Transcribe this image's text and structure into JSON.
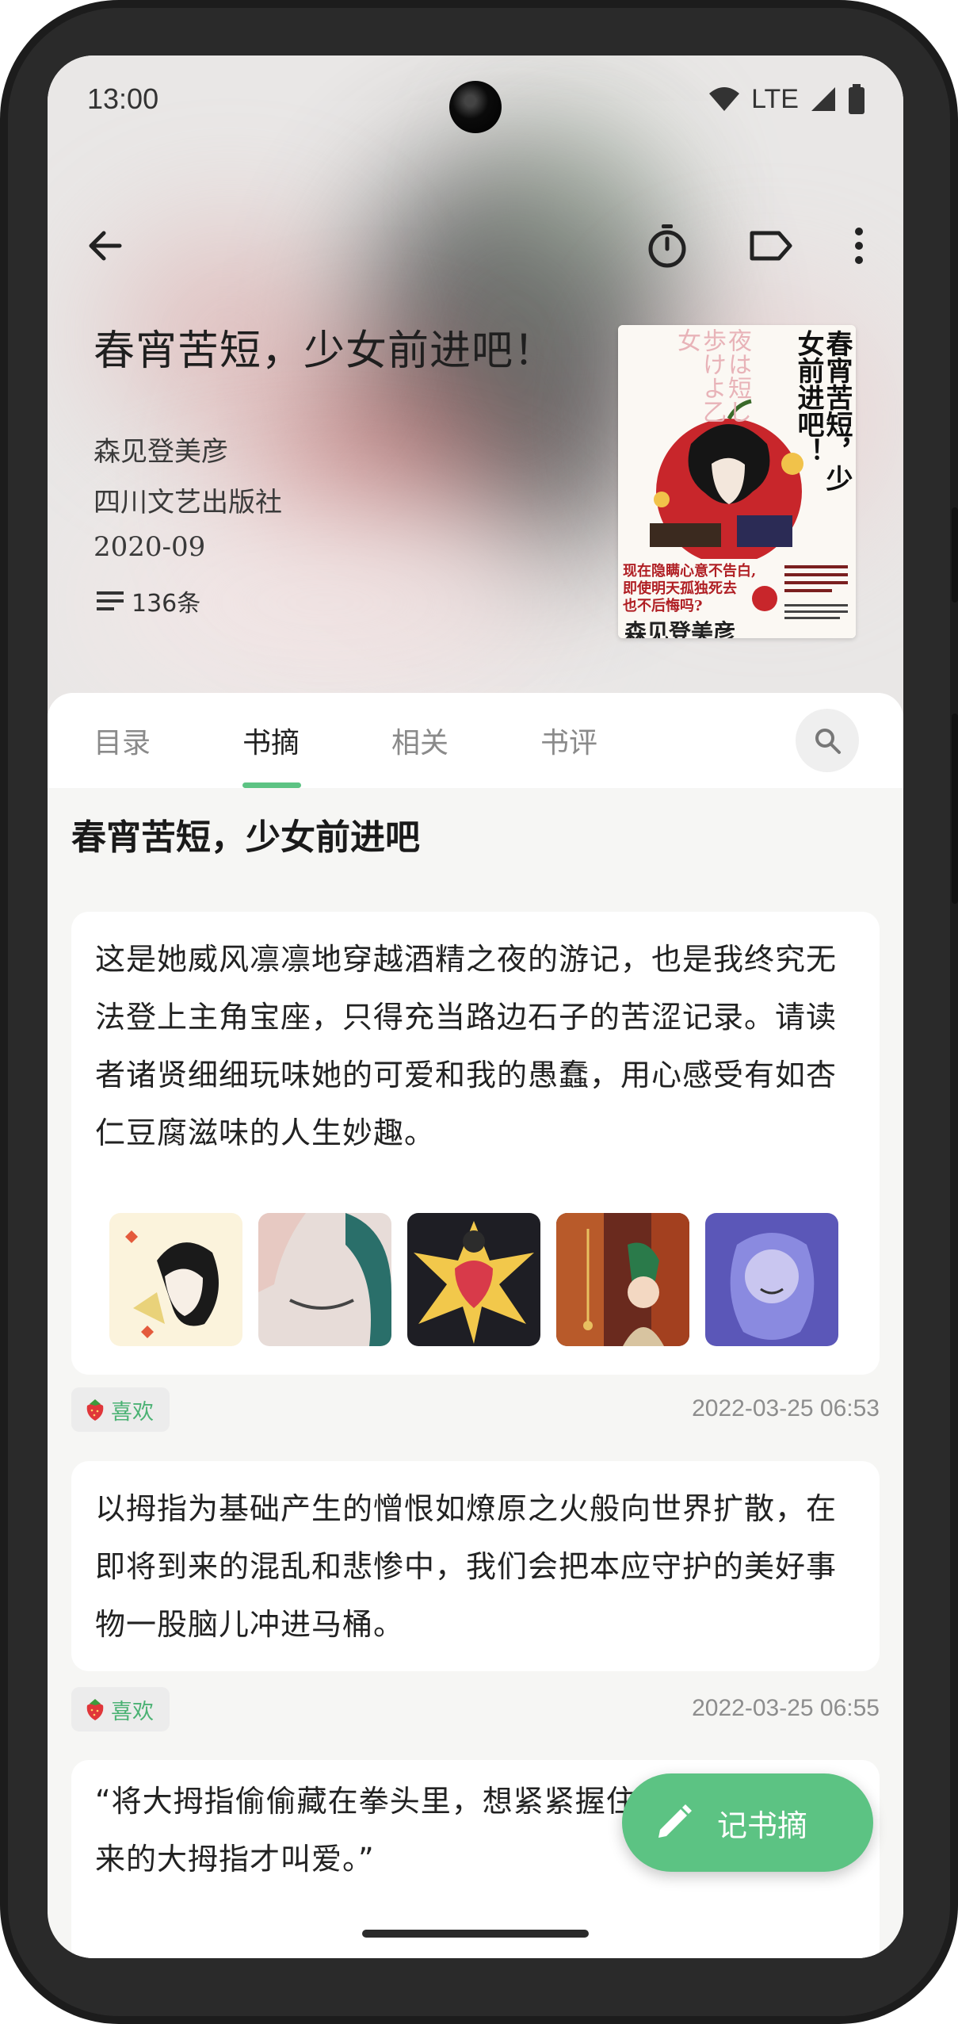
{
  "status": {
    "time": "13:00",
    "network": "LTE"
  },
  "toolbar": {
    "back_icon": "arrow-left-icon",
    "timer_icon": "stopwatch-icon",
    "tag_icon": "label-tag-icon",
    "more_icon": "more-vert-icon"
  },
  "book": {
    "title": "春宵苦短，少女前进吧！",
    "author": "森见登美彦",
    "publisher": "四川文艺出版社",
    "date": "2020-09",
    "count": "136条",
    "cover": {
      "title_vertical": "春宵苦短，少女前进吧！",
      "japanese": "夜は短し歩けよ乙女",
      "blurb_line1": "现在隐瞒心意不告白,",
      "blurb_line2": "即使明天孤独死去",
      "blurb_line3": "也不后悔吗?",
      "author": "森见登美彦"
    }
  },
  "tabs": [
    {
      "label": "目录"
    },
    {
      "label": "书摘"
    },
    {
      "label": "相关"
    },
    {
      "label": "书评"
    }
  ],
  "section": {
    "title": "春宵苦短，少女前进吧"
  },
  "excerpts": [
    {
      "text": "这是她威风凛凛地穿越酒精之夜的游记，也是我终究无法登上主角宝座，只得充当路边石子的苦涩记录。请读者诸贤细细玩味她的可爱和我的愚蠢，用心感受有如杏仁豆腐滋味的人生妙趣。",
      "like_label": "喜欢",
      "timestamp": "2022-03-25 06:53"
    },
    {
      "text": "以拇指为基础产生的憎恨如燎原之火般向世界扩散，在即将到来的混乱和悲惨中，我们会把本应守护的美好事物一股脑儿冲进马桶。",
      "like_label": "喜欢",
      "timestamp": "2022-03-25 06:55"
    },
    {
      "text": "“将大拇指偷偷藏在拳头里，想紧紧握住，那根偷偷藏起来的大拇指才叫爱。”"
    }
  ],
  "fab": {
    "label": "记书摘",
    "icon": "pencil-icon"
  },
  "colors": {
    "accent": "#5cc383",
    "like_text": "#4bb274"
  }
}
